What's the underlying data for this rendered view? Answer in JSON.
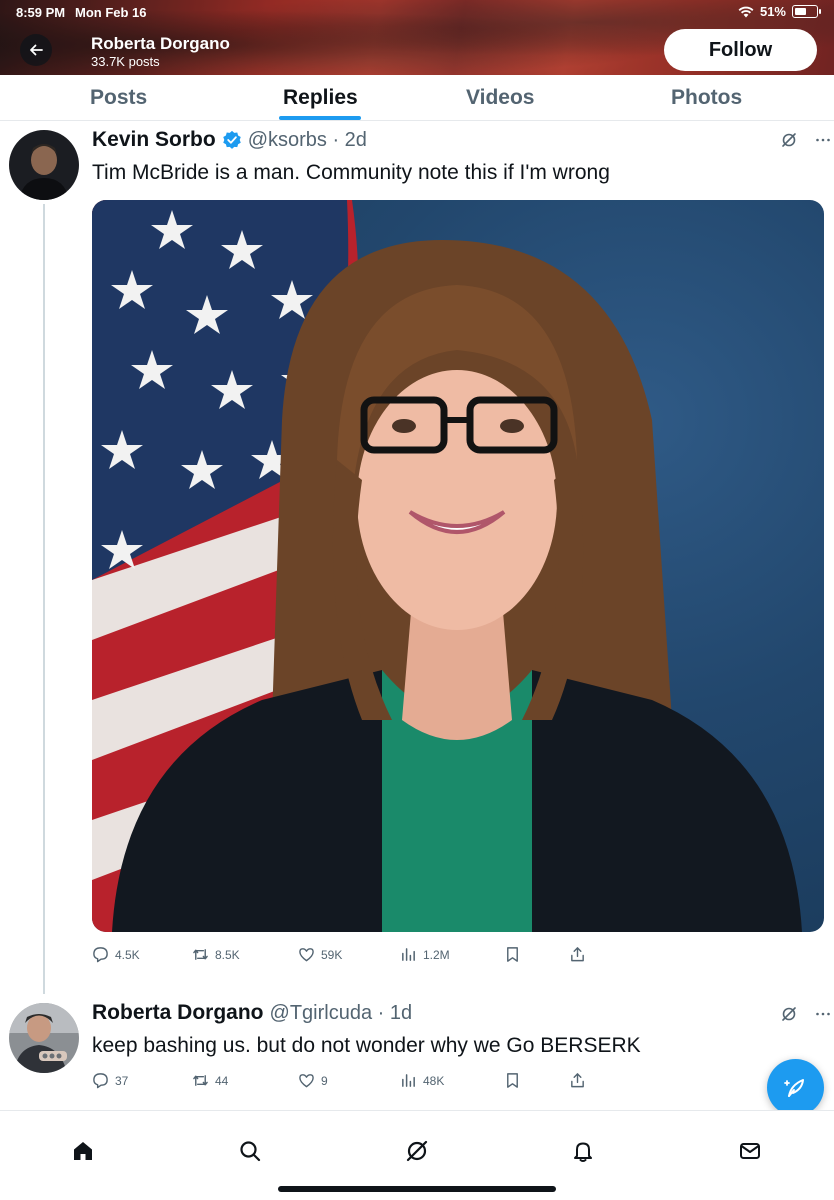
{
  "status_bar": {
    "time": "8:59 PM",
    "date": "Mon Feb 16",
    "battery": "51%"
  },
  "header": {
    "name": "Roberta Dorgano",
    "posts": "33.7K posts",
    "follow_label": "Follow"
  },
  "tabs": [
    {
      "label": "Posts",
      "active": false
    },
    {
      "label": "Replies",
      "active": true
    },
    {
      "label": "Videos",
      "active": false
    },
    {
      "label": "Photos",
      "active": false
    }
  ],
  "tweets": [
    {
      "name": "Kevin Sorbo",
      "handle": "@ksorbs · 2d",
      "verified": true,
      "text": "Tim McBride is a man. Community note this if I'm wrong",
      "has_photo": true,
      "stats": {
        "replies": "4.5K",
        "reposts": "8.5K",
        "likes": "59K",
        "views": "1.2M"
      }
    },
    {
      "name": "Roberta Dorgano",
      "handle": "@Tgirlcuda · 1d",
      "verified": false,
      "text": "keep bashing us. but do not wonder why we Go BERSERK",
      "has_photo": false,
      "stats": {
        "replies": "37",
        "reposts": "44",
        "likes": "9",
        "views": "48K"
      }
    }
  ],
  "icons": {
    "back": "arrow-left-icon",
    "verified": "verified-badge-icon",
    "grok": "grok-icon",
    "more": "more-icon",
    "reply": "reply-icon",
    "repost": "repost-icon",
    "like": "heart-icon",
    "views": "views-icon",
    "bookmark": "bookmark-icon",
    "share": "share-icon",
    "compose": "compose-icon",
    "nav": [
      "home-icon",
      "search-icon",
      "grok-icon",
      "notifications-icon",
      "messages-icon"
    ]
  },
  "colors": {
    "accent": "#1d9bf0",
    "text": "#0f1419",
    "secondary": "#536471"
  }
}
